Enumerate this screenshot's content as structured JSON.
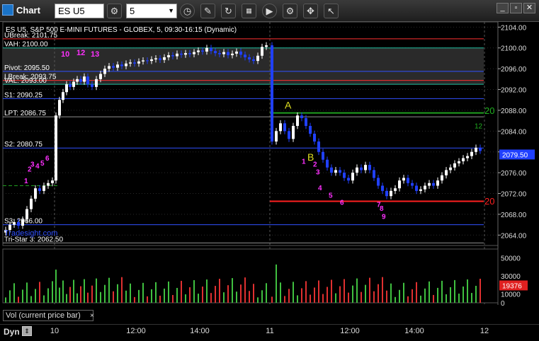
{
  "window": {
    "title": "Chart",
    "symbol": "ES U5",
    "interval": "5",
    "controls": [
      "minimize",
      "restore",
      "close"
    ]
  },
  "toolbar_icons": [
    "search-icon",
    "clock-icon",
    "pencil-icon",
    "refresh-icon",
    "indicator-icon",
    "play-icon",
    "settings-icon",
    "pin-icon",
    "cursor-icon"
  ],
  "chart": {
    "header_text": "ES U5, S&P 500 E-MINI FUTURES - GLOBEX, 5, 09:30-16:15 (Dynamic)",
    "y_axis": {
      "ticks": [
        "2104.00",
        "2100.00",
        "2096.00",
        "2092.00",
        "2088.00",
        "2084.00",
        "2080.00",
        "2076.00",
        "2072.00",
        "2068.00",
        "2064.00"
      ],
      "min": 2062,
      "max": 2105
    },
    "current_price": "2079.50",
    "x_axis": {
      "ticks": [
        "10",
        "12:00",
        "14:00",
        "11",
        "12:00",
        "14:00",
        "12"
      ]
    },
    "levels": [
      {
        "label": "UBreak: 2101.75",
        "price": 2101.75,
        "color": "#ff3030"
      },
      {
        "label": "VAH: 2100.00",
        "price": 2100.0,
        "color": "#20c0a0"
      },
      {
        "label": "Pivot: 2095.50",
        "price": 2095.5,
        "color": "#3050ff"
      },
      {
        "label": "LBreak: 2093.75",
        "price": 2093.75,
        "color": "#ff3030"
      },
      {
        "label": "VAL: 2093.00",
        "price": 2093.0,
        "color": "#20c0a0"
      },
      {
        "label": "S1: 2090.25",
        "price": 2090.25,
        "color": "#3050ff"
      },
      {
        "label": "LPT: 2086.75",
        "price": 2086.75,
        "color": "#909090"
      },
      {
        "label": "S2: 2080.75",
        "price": 2080.75,
        "color": "#3050ff"
      },
      {
        "label": "S3: 2066.00",
        "price": 2066.0,
        "color": "#3050ff"
      },
      {
        "label": "Tri-Star 3: 2062.50",
        "price": 2062.5,
        "color": "#909090"
      }
    ],
    "annotations": {
      "A": "A",
      "B": "B",
      "green_20": "20",
      "red_20": "20",
      "seq_top": [
        "10",
        "12",
        "13"
      ],
      "seq_day1": [
        "1",
        "2",
        "3",
        "4",
        "5",
        "6"
      ],
      "seq_down": [
        "1",
        "2",
        "3",
        "4",
        "5",
        "6",
        "7",
        "8",
        "9"
      ],
      "seq_green": [
        "12"
      ],
      "watermark": "Tradesight.com"
    }
  },
  "volume": {
    "label": "Vol (current price bar)",
    "close": "×",
    "y_axis": {
      "ticks": [
        "50000",
        "30000",
        "10000",
        "0"
      ]
    },
    "current_value": "19376"
  },
  "bottom": {
    "mode": "Dyn"
  }
}
